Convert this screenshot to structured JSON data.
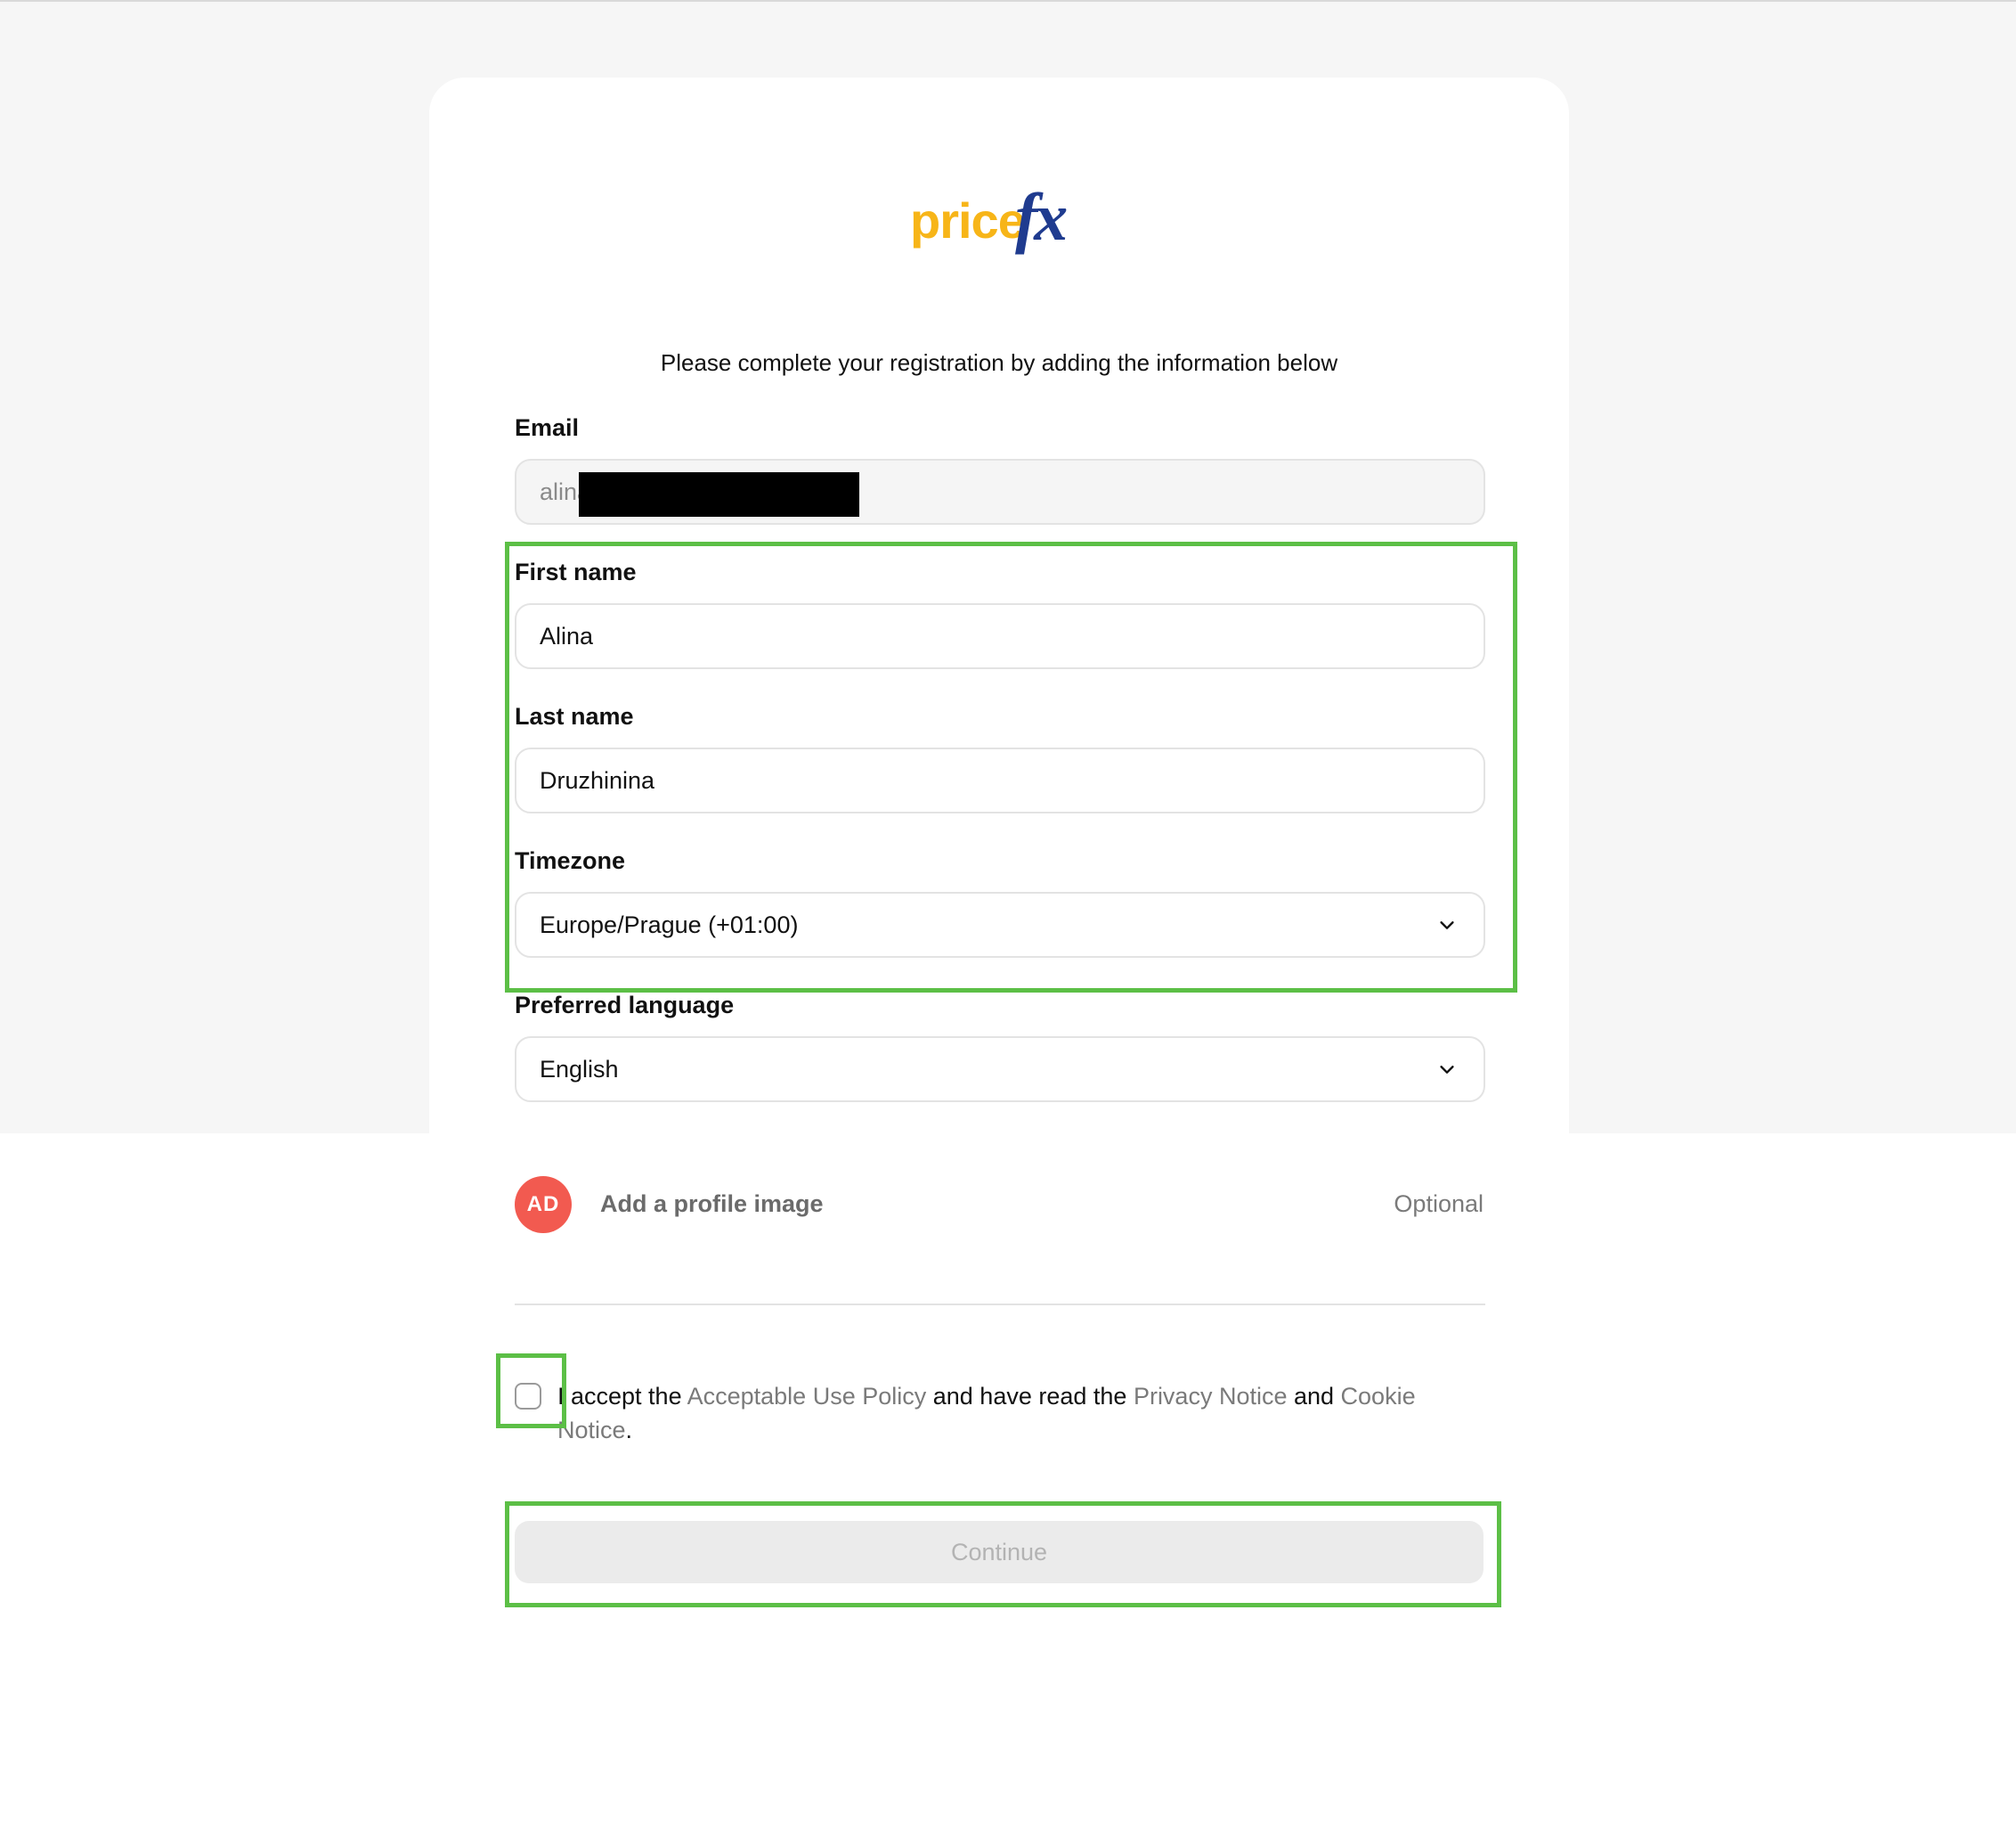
{
  "logo": {
    "part1": "price",
    "part2": "fx"
  },
  "intro_text": "Please complete your registration by adding the information below",
  "form": {
    "email": {
      "label": "Email",
      "value": "alina"
    },
    "first_name": {
      "label": "First name",
      "value": "Alina"
    },
    "last_name": {
      "label": "Last name",
      "value": "Druzhinina"
    },
    "timezone": {
      "label": "Timezone",
      "value": "Europe/Prague (+01:00)"
    },
    "language": {
      "label": "Preferred language",
      "value": "English"
    }
  },
  "profile": {
    "initials": "AD",
    "label": "Add a profile image",
    "optional": "Optional"
  },
  "terms": {
    "t1": "I accept the ",
    "link1": "Acceptable Use Policy",
    "t2": " and have read the ",
    "link2": "Privacy Notice",
    "t3": " and ",
    "link3": "Cookie Notice",
    "t4": "."
  },
  "continue_label": "Continue",
  "colors": {
    "highlight": "#5cbf46",
    "logo_yellow": "#f7b518",
    "logo_blue": "#1f3b8f",
    "avatar_red": "#f25a50"
  },
  "icons": {
    "dropdown": "chevron-down-icon"
  }
}
